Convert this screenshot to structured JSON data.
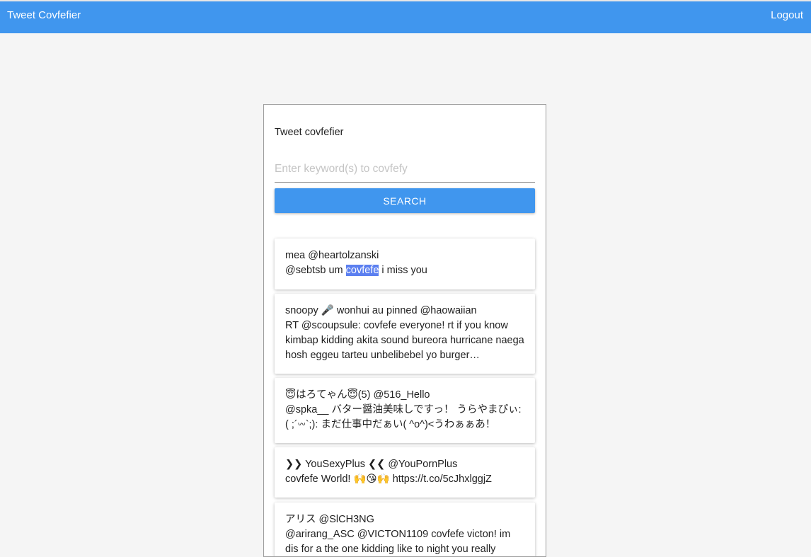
{
  "header": {
    "app_title": "Tweet Covfefier",
    "logout_label": "Logout",
    "bar_color": "#4096ee"
  },
  "search": {
    "title": "Tweet covfefier",
    "placeholder": "Enter keyword(s) to covfefy",
    "value": "",
    "button_label": "SEARCH"
  },
  "tweets": [
    {
      "author": "mea @heartolzanski",
      "text_before": "@sebtsb um ",
      "highlight": "covfefe",
      "text_after": " i miss you"
    },
    {
      "author": "snoopy 🎤 wonhui au pinned @haowaiian",
      "text": "RT @scoupsule: covfefe everyone! rt if you know kimbap kidding akita sound bureora hurricane naega hosh eggeu tarteu unbelibebel yo burger…"
    },
    {
      "author": "😇はろてゃん😇(5) @516_Hello",
      "text": "@spka__ バター醤油美味しですっ！ うらやまぴぃ: ( ;´𖥦`;): まだ仕事中だぁい( ^o^)<うわぁぁあ！"
    },
    {
      "author": "❯❯ YouSexyPlus ❮❮ @YouPornPlus",
      "text": "covfefe World! 🙌😘🙌 https://t.co/5cJhxlggjZ"
    },
    {
      "author": "アリス @SlCH3NG",
      "text": "@arirang_ASC @VICTON1109 covfefe victon! im dis for a the one kidding like to night you really"
    }
  ],
  "colors": {
    "highlight": "#5b7ff0",
    "panel_border": "#9e9e9e"
  }
}
